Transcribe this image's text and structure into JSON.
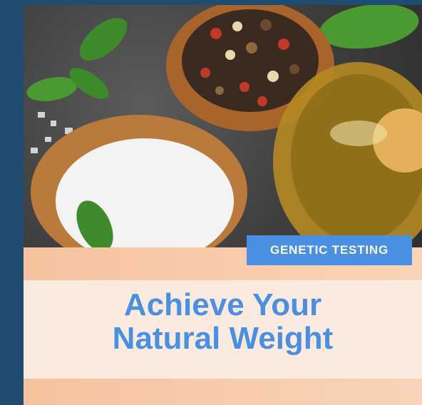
{
  "tag": {
    "label": "GENETIC TESTING"
  },
  "headline": {
    "line1": "Achieve Your",
    "line2": "Natural Weight"
  },
  "colors": {
    "frame": "#1f4d72",
    "accent_blue": "#4a90e2",
    "peach": "#f6c29e",
    "cream": "#fbeadf"
  }
}
